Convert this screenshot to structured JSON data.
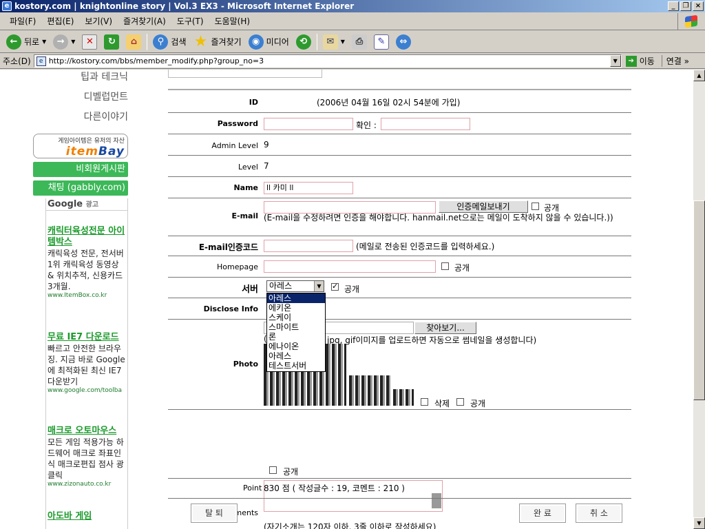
{
  "window": {
    "title": "kostory.com | knightonline story | Vol.3 EX3 - Microsoft Internet Explorer"
  },
  "menu": [
    "파일(F)",
    "편집(E)",
    "보기(V)",
    "즐겨찾기(A)",
    "도구(T)",
    "도움말(H)"
  ],
  "toolbar": {
    "back": "뒤로",
    "search": "검색",
    "favorites": "즐겨찾기",
    "media": "미디어"
  },
  "address": {
    "label": "주소(D)",
    "url": "http://kostory.com/bbs/member_modify.php?group_no=3",
    "go": "이동",
    "links": "연결 »"
  },
  "sidebar": {
    "links": [
      "팁과 테크닉",
      "디벨럽먼트",
      "다른이야기"
    ],
    "itembay_small": "게임아이템은 유저의 자산",
    "itembay_brand_a": "item",
    "itembay_brand_b": "Bay",
    "green1": "비회원게시판",
    "green2": "채팅 (gabbly.com)",
    "google": "Google",
    "google_ad_label": "광고",
    "ads": [
      {
        "title": "캐릭터육성전문 아이템박스",
        "body": "캐릭육성 전문, 전서버 1위 캐릭육성 동영상 & 위치추적, 신용카드 3개월.",
        "url": "www.ItemBox.co.kr"
      },
      {
        "title": "무료 IE7 다운로드",
        "body": "빠르고 안전한 브라우징. 지금 바로 Google에 최적화된 최신 IE7 다운받기",
        "url": "www.google.com/toolba"
      },
      {
        "title": "매크로 오토마우스",
        "body": "모든 게임 적용가능 하드웨어 매크로 좌표인식 매크로편집 점사 광클릭",
        "url": "www.zizonauto.co.kr"
      }
    ],
    "more": "아도바 게임"
  },
  "form": {
    "prev_box": "",
    "id_label": "ID",
    "id_value": "(2006년 04월 16일 02시 54분에 가입)",
    "password_label": "Password",
    "confirm_label": "확인 :",
    "admin_level_label": "Admin Level",
    "admin_level_value": "9",
    "level_label": "Level",
    "level_value": "7",
    "name_label": "Name",
    "name_value": "ll 카미 ll",
    "email_label": "E-mail",
    "email_button": "인증메일보내기",
    "public": "공개",
    "email_note": "(E-mail을 수정하려면 인증을 해야합니다. hanmail.net으로는 메일이 도착하지 않을 수 있습니다.))",
    "email_code_label": "E-mail인증코드",
    "email_code_note": "(메일로 전송된 인증코드를 입력하세요.)",
    "homepage_label": "Homepage",
    "server_label": "서버",
    "server_selected": "아레스",
    "server_options": [
      "아레스",
      "에키온",
      "스케이",
      "스마이트",
      "론",
      "에나이온",
      "아레스",
      "테스트서버"
    ],
    "disclose_label": "Disclose Info",
    "photo_label": "Photo",
    "browse_button": "찾아보기...",
    "photo_note_prefix": "(",
    "photo_note": "jpg, gif이미지를 업로드하면 자동으로 썸네일을 생성합니다)",
    "delete_label": "삭제",
    "comments_label": "Comments",
    "comments_note": "(자기소개는 120자 이하, 3줄 이하로 작성하세요)",
    "point_label": "Point",
    "point_value": "830 점 ( 작성글수 : 19, 코멘트 : 210 )",
    "withdraw": "탈 퇴",
    "done": "완 료",
    "cancel": "취 소"
  }
}
